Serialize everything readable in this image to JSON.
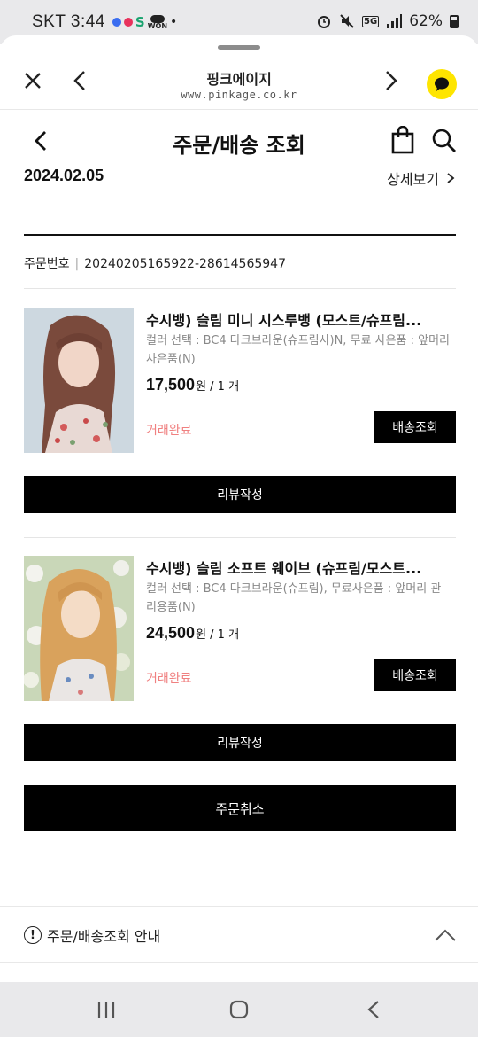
{
  "status_bar": {
    "carrier_time": "SKT 3:44",
    "network_badge": "5G",
    "battery": "62%",
    "won_label": "WON"
  },
  "browser": {
    "title": "핑크에이지",
    "url": "www.pinkage.co.kr"
  },
  "header": {
    "title": "주문/배송 조회"
  },
  "order": {
    "date": "2024.02.05",
    "detail_link": "상세보기",
    "number_label": "주문번호",
    "number_separator": "|",
    "number": "20240205165922-28614565947"
  },
  "items": [
    {
      "name": "수시뱅) 슬림 미니 시스루뱅 (모스트/슈프림...",
      "options": "컬러 선택 : BC4 다크브라운(슈프림사)N, 무료 사은품 : 앞머리 사은품(N)",
      "price": "17,500",
      "price_unit": "원 / 1 개",
      "status": "거래완료",
      "track_button": "배송조회",
      "review_button": "리뷰작성"
    },
    {
      "name": "수시뱅) 슬림 소프트 웨이브 (슈프림/모스트...",
      "options": "컬러 선택 : BC4 다크브라운(슈프림), 무료사은품 : 앞머리 관리용품(N)",
      "price": "24,500",
      "price_unit": "원 / 1 개",
      "status": "거래완료",
      "track_button": "배송조회",
      "review_button": "리뷰작성"
    }
  ],
  "cancel_button": "주문취소",
  "info_section": {
    "label": "주문/배송조회 안내",
    "icon": "!"
  },
  "colors": {
    "status_text": "#f08080",
    "button_bg": "#000000",
    "kakao": "#FEE500"
  },
  "icons": [
    "close-icon",
    "back-icon",
    "forward-icon",
    "kakao-chat-icon",
    "shopping-bag-icon",
    "search-icon",
    "chevron-right-icon",
    "info-icon",
    "chevron-up-icon"
  ]
}
